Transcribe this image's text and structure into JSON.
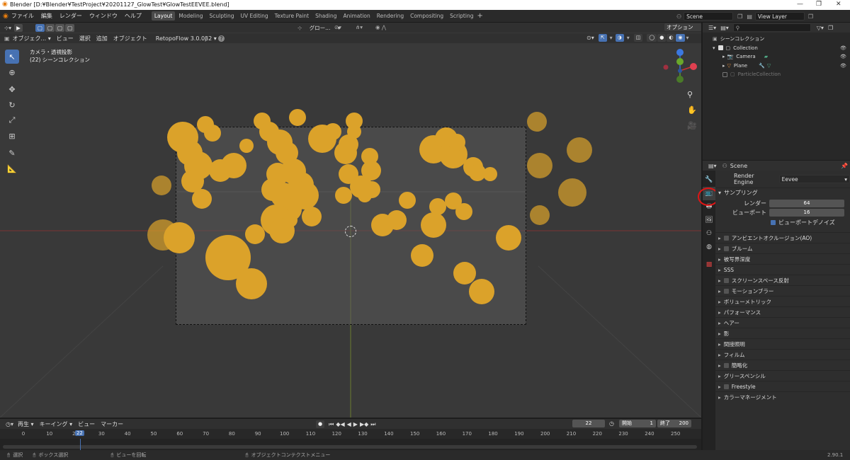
{
  "window": {
    "title": "Blender [D:¥Blender¥TestProject¥20201127_GlowTest¥GlowTestEEVEE.blend]"
  },
  "menu": [
    "ファイル",
    "編集",
    "レンダー",
    "ウィンドウ",
    "ヘルプ"
  ],
  "workspaces": [
    {
      "label": "Layout",
      "active": true
    },
    {
      "label": "Modeling"
    },
    {
      "label": "Sculpting"
    },
    {
      "label": "UV Editing"
    },
    {
      "label": "Texture Paint"
    },
    {
      "label": "Shading"
    },
    {
      "label": "Animation"
    },
    {
      "label": "Rendering"
    },
    {
      "label": "Compositing"
    },
    {
      "label": "Scripting"
    }
  ],
  "scene_field": "Scene",
  "viewlayer_field": "View Layer",
  "viewport_header": {
    "mode": "オブジェク...",
    "menus": [
      "ビュー",
      "選択",
      "追加",
      "オブジェクト"
    ],
    "addon": "RetopoFlow 3.0.0β2",
    "orientation": "グロー...",
    "options": "オプション"
  },
  "viewport_overlay": {
    "line1": "カメラ・透視投影",
    "line2": "(22) シーンコレクション"
  },
  "outliner": {
    "root": "シーンコレクション",
    "items": [
      {
        "label": "Collection",
        "indent": 1
      },
      {
        "label": "Camera",
        "indent": 2
      },
      {
        "label": "Plane",
        "indent": 2
      },
      {
        "label": "ParticleCollection",
        "indent": 1,
        "disabled": true
      }
    ]
  },
  "properties": {
    "scene_label": "Scene",
    "render_engine_label": "Render Engine",
    "render_engine_value": "Eevee",
    "sampling_header": "サンプリング",
    "render_label": "レンダー",
    "render_value": "64",
    "viewport_label": "ビューポート",
    "viewport_value": "16",
    "denoise_label": "ビューポートデノイズ",
    "panels": [
      {
        "label": "アンビエントオクルージョン(AO)",
        "check": true
      },
      {
        "label": "ブルーム",
        "check": true
      },
      {
        "label": "被写界深度",
        "check": false
      },
      {
        "label": "SSS",
        "check": false
      },
      {
        "label": "スクリーンスペース反射",
        "check": true
      },
      {
        "label": "モーションブラー",
        "check": true
      },
      {
        "label": "ボリューメトリック",
        "check": false
      },
      {
        "label": "パフォーマンス",
        "check": false
      },
      {
        "label": "ヘアー",
        "check": false
      },
      {
        "label": "影",
        "check": false
      },
      {
        "label": "間接照明",
        "check": false
      },
      {
        "label": "フィルム",
        "check": false
      },
      {
        "label": "簡略化",
        "check": true
      },
      {
        "label": "グリースペンシル",
        "check": false
      },
      {
        "label": "Freestyle",
        "check": true
      },
      {
        "label": "カラーマネージメント",
        "check": false
      }
    ]
  },
  "timeline": {
    "menus": [
      "再生",
      "キーイング",
      "ビュー",
      "マーカー"
    ],
    "current_frame": "22",
    "start_label": "開始",
    "start_value": "1",
    "end_label": "終了",
    "end_value": "200",
    "ticks": [
      "0",
      "10",
      "20",
      "30",
      "40",
      "50",
      "60",
      "70",
      "80",
      "90",
      "100",
      "110",
      "120",
      "130",
      "140",
      "150",
      "160",
      "170",
      "180",
      "190",
      "200",
      "210",
      "220",
      "230",
      "240",
      "250"
    ]
  },
  "status": {
    "select": "選択",
    "box": "ボックス選択",
    "rotate": "ビューを回転",
    "context": "オブジェクトコンテクストメニュー",
    "version": "2.90.1"
  }
}
